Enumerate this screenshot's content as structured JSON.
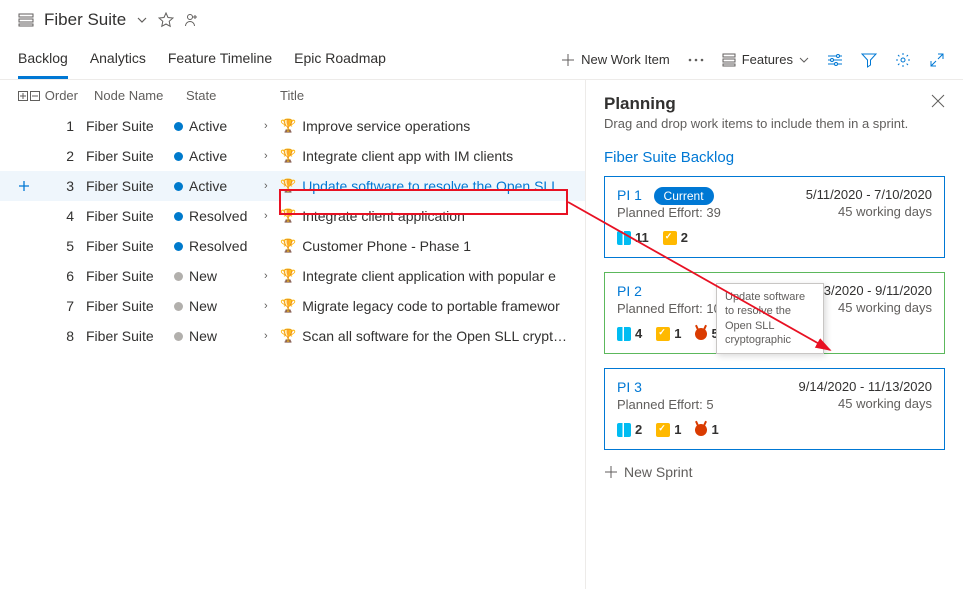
{
  "header": {
    "title": "Fiber Suite"
  },
  "tabs": {
    "backlog": "Backlog",
    "analytics": "Analytics",
    "feature_timeline": "Feature Timeline",
    "epic_roadmap": "Epic Roadmap"
  },
  "toolbar": {
    "new_work_item": "New Work Item",
    "features": "Features"
  },
  "columns": {
    "order": "Order",
    "node": "Node Name",
    "state": "State",
    "title": "Title"
  },
  "state_labels": {
    "active": "Active",
    "resolved": "Resolved",
    "new": "New"
  },
  "rows": [
    {
      "order": "1",
      "node": "Fiber Suite",
      "state": "active",
      "title": "Improve service operations",
      "chev": true
    },
    {
      "order": "2",
      "node": "Fiber Suite",
      "state": "active",
      "title": "Integrate client app with IM clients",
      "chev": true
    },
    {
      "order": "3",
      "node": "Fiber Suite",
      "state": "active",
      "title": "Update software to resolve the Open SLL",
      "chev": true,
      "hl": true
    },
    {
      "order": "4",
      "node": "Fiber Suite",
      "state": "resolved",
      "title": "Integrate client application",
      "chev": true
    },
    {
      "order": "5",
      "node": "Fiber Suite",
      "state": "resolved",
      "title": "Customer Phone - Phase 1",
      "chev": false
    },
    {
      "order": "6",
      "node": "Fiber Suite",
      "state": "new",
      "title": "Integrate client application with popular e",
      "chev": true
    },
    {
      "order": "7",
      "node": "Fiber Suite",
      "state": "new",
      "title": "Migrate legacy code to portable framewor",
      "chev": true
    },
    {
      "order": "8",
      "node": "Fiber Suite",
      "state": "new",
      "title": "Scan all software for the Open SLL cryptog",
      "chev": true
    }
  ],
  "panel": {
    "title": "Planning",
    "subtitle": "Drag and drop work items to include them in a sprint.",
    "backlog_title": "Fiber Suite Backlog",
    "new_sprint": "New Sprint",
    "drag_tooltip": "Update software to resolve the Open SLL cryptographic",
    "sprints": [
      {
        "name": "PI 1",
        "current": true,
        "current_label": "Current",
        "dates": "5/11/2020 - 7/10/2020",
        "days": "45 working days",
        "effort_label": "Planned Effort: 39",
        "feat": "11",
        "task": "2",
        "bug": "",
        "green": false
      },
      {
        "name": "PI 2",
        "current": false,
        "dates": "7/13/2020 - 9/11/2020",
        "days": "45 working days",
        "effort_label": "Planned Effort: 10",
        "feat": "4",
        "task": "1",
        "bug": "5",
        "green": true
      },
      {
        "name": "PI 3",
        "current": false,
        "dates": "9/14/2020 - 11/13/2020",
        "days": "45 working days",
        "effort_label": "Planned Effort: 5",
        "feat": "2",
        "task": "1",
        "bug": "1",
        "green": false
      }
    ]
  }
}
